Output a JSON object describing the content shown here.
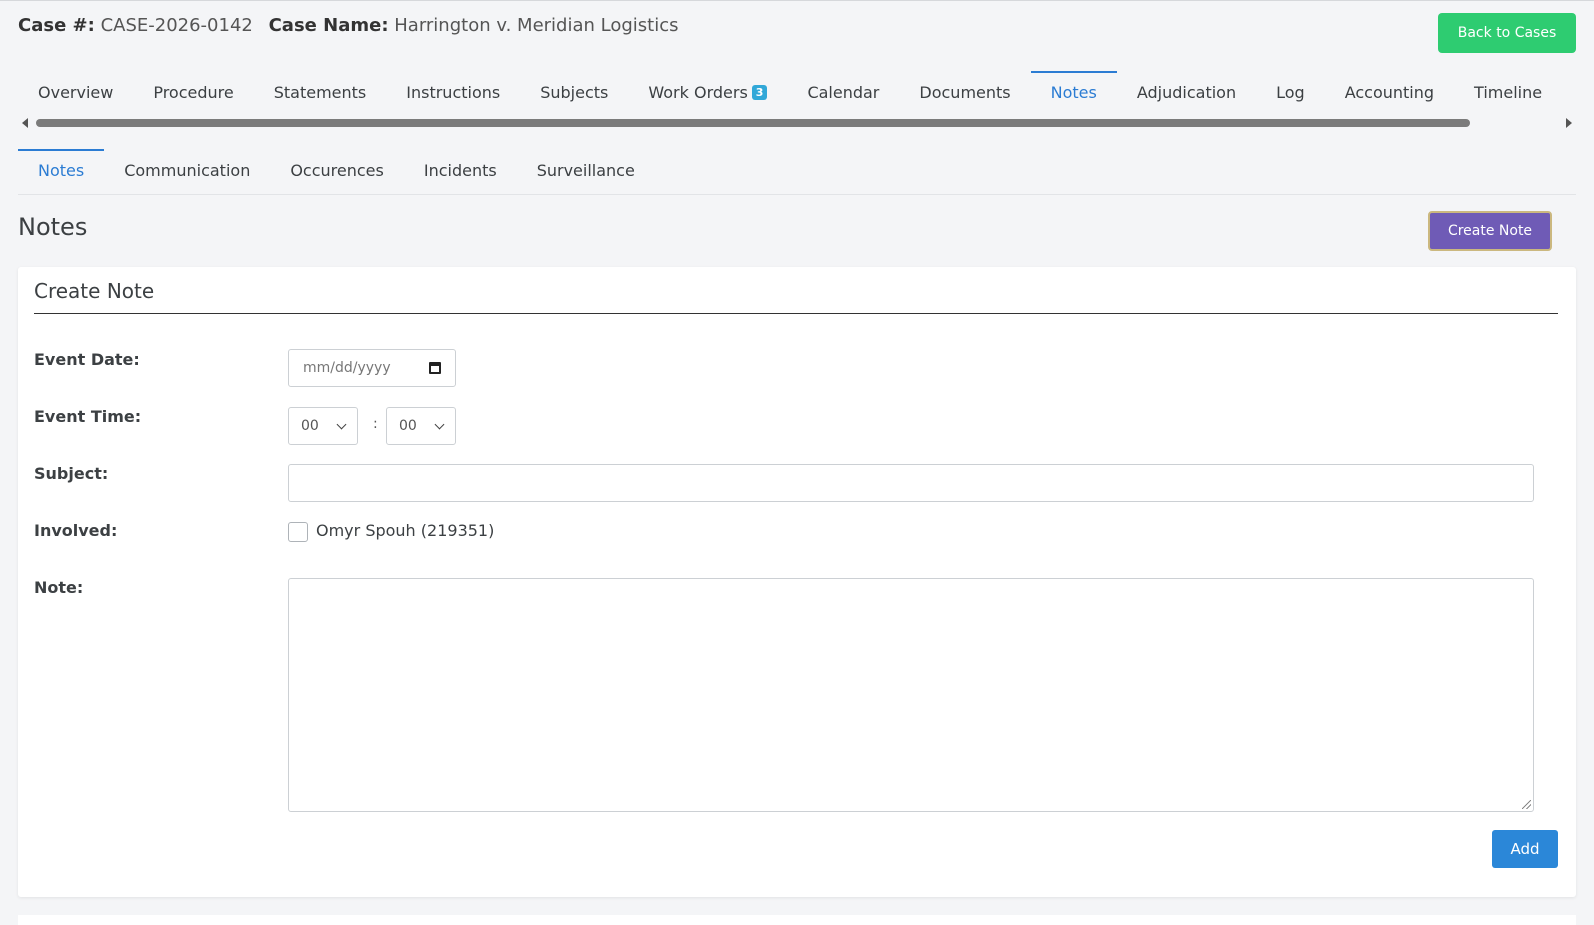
{
  "header": {
    "case_no_label": "Case #:",
    "case_no_value": "CASE-2026-0142",
    "case_name_label": "Case Name:",
    "case_name_value": "Harrington v. Meridian Logistics",
    "back_label": "Back to Cases"
  },
  "tabs": [
    {
      "label": "Overview"
    },
    {
      "label": "Procedure"
    },
    {
      "label": "Statements"
    },
    {
      "label": "Instructions"
    },
    {
      "label": "Subjects"
    },
    {
      "label": "Work Orders",
      "badge": "3"
    },
    {
      "label": "Calendar"
    },
    {
      "label": "Documents"
    },
    {
      "label": "Notes",
      "active": true
    },
    {
      "label": "Adjudication"
    },
    {
      "label": "Log"
    },
    {
      "label": "Accounting"
    },
    {
      "label": "Timeline"
    }
  ],
  "subtabs": [
    {
      "label": "Notes",
      "active": true
    },
    {
      "label": "Communication"
    },
    {
      "label": "Occurences"
    },
    {
      "label": "Incidents"
    },
    {
      "label": "Surveillance"
    }
  ],
  "section": {
    "title": "Notes",
    "create_button": "Create Note"
  },
  "form": {
    "title": "Create Note",
    "event_date_label": "Event Date:",
    "event_date_placeholder": "mm/dd/yyyy",
    "event_time_label": "Event Time:",
    "hour_value": "00",
    "minute_value": "00",
    "time_separator": ":",
    "subject_label": "Subject:",
    "subject_value": "",
    "involved_label": "Involved:",
    "involved_option": "Omyr Spouh (219351)",
    "note_label": "Note:",
    "note_value": "",
    "add_button": "Add"
  },
  "colors": {
    "accent": "#2b7cd3",
    "back_button": "#2ecc71",
    "create_button": "#6f5bb6",
    "add_button": "#2b87d8",
    "badge": "#31a8d8"
  }
}
